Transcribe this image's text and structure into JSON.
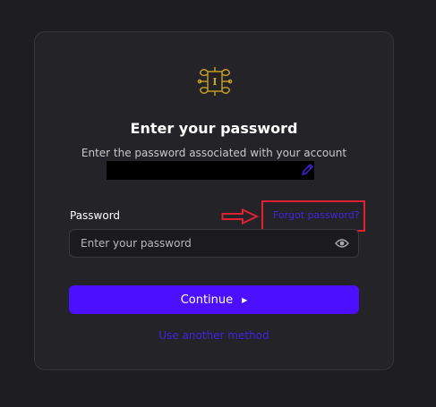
{
  "card": {
    "title": "Enter your password",
    "subtitle": "Enter the password associated with your account"
  },
  "password": {
    "label": "Password",
    "placeholder": "Enter your password",
    "value": ""
  },
  "links": {
    "forgot_password": "Forgot password?",
    "use_another_method": "Use another method"
  },
  "buttons": {
    "continue_label": "Continue"
  },
  "icons": {
    "logo": "ornate-monogram-logo-icon",
    "edit": "pencil-icon",
    "eye": "eye-icon",
    "continue": "play-triangle-icon",
    "annotation": "arrow-right-icon"
  },
  "colors": {
    "page_background": "#1e1d21",
    "card_background": "#242328",
    "accent": "#4d0fff",
    "link": "#4422e0",
    "logo_gold": "#c9a227",
    "annotation_red": "#e0212f"
  }
}
